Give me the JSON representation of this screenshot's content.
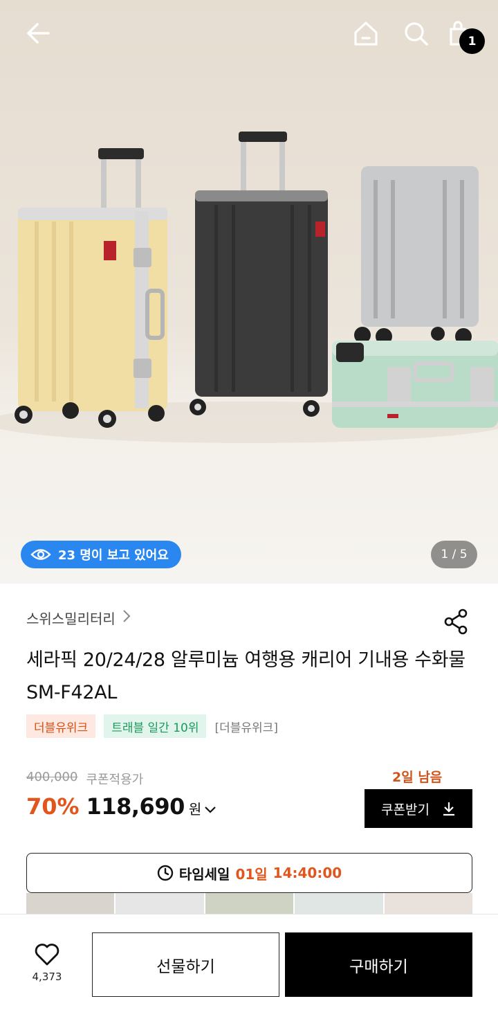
{
  "header": {
    "cart_count": "1",
    "icons": [
      "back-arrow-icon",
      "home-icon",
      "search-icon",
      "shopping-bag-icon"
    ]
  },
  "hero": {
    "viewers_text": "23 명이 보고 있어요",
    "pager_text": "1 / 5",
    "suitcase_colors": [
      "#f1dea4",
      "#3b3b3b",
      "#c8cacc",
      "#b9dcc9"
    ]
  },
  "product": {
    "brand": "스위스밀리터리",
    "title": "세라픽 20/24/28 알루미늄 여행용 캐리어 기내용 수화물 SM-F42AL",
    "tags": [
      {
        "label": "더블유위크",
        "style": "orange"
      },
      {
        "label": "트래블 일간 10위",
        "style": "green"
      },
      {
        "label": "[더블유위크]",
        "style": "plain"
      }
    ],
    "original_price": "400,000",
    "coupon_price_label": "쿠폰적용가",
    "days_left": "2일 남음",
    "discount": "70%",
    "price": "118,690",
    "currency": "원",
    "coupon_button": "쿠폰받기"
  },
  "timesale": {
    "label": "타임세일",
    "days": "01일",
    "time": "14:40:00"
  },
  "bottom": {
    "like_count": "4,373",
    "gift_label": "선물하기",
    "buy_label": "구매하기"
  },
  "colors": {
    "accent": "#e0561c",
    "viewers_bg": "#2b87f0",
    "black": "#000000"
  }
}
